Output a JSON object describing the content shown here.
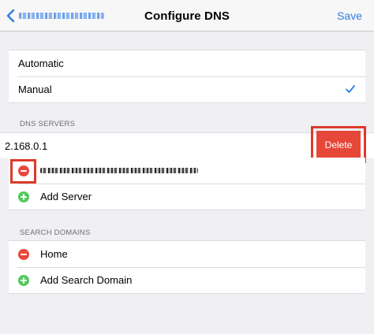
{
  "navbar": {
    "title": "Configure DNS",
    "save_label": "Save"
  },
  "mode": {
    "automatic_label": "Automatic",
    "manual_label": "Manual",
    "selected": "Manual"
  },
  "dns_servers": {
    "header": "DNS SERVERS",
    "swiped_server": "2.168.0.1",
    "delete_label": "Delete",
    "add_label": "Add Server"
  },
  "search_domains": {
    "header": "SEARCH DOMAINS",
    "items": [
      {
        "label": "Home"
      }
    ],
    "add_label": "Add Search Domain"
  },
  "colors": {
    "accent": "#2f7de1",
    "delete": "#e64739",
    "remove": "#e9473c",
    "add": "#54c95c",
    "highlight": "#dd3a2b"
  }
}
